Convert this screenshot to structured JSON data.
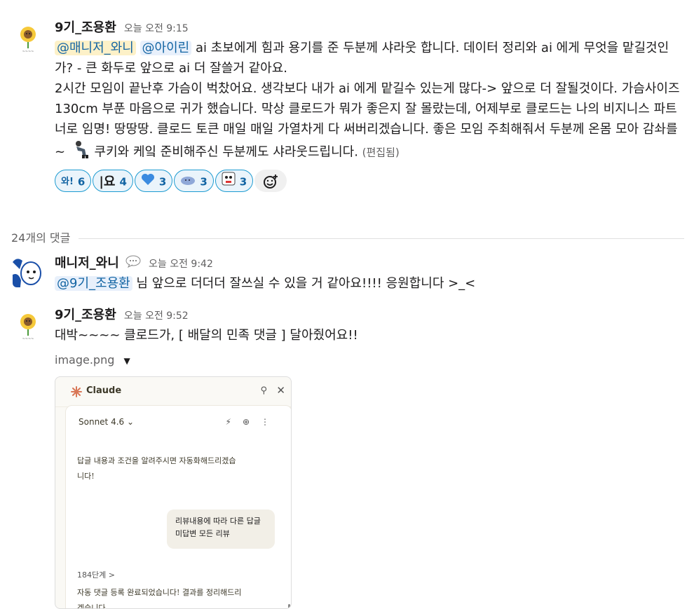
{
  "thread": {
    "main_message": {
      "author": "9기_조용환",
      "time": "오늘 오전 9:15",
      "mention1": "@매니저_와니",
      "mention2": "@아이린",
      "text_seg1": " ai 초보에게 힘과 용기를 준 두분께 샤라웃 합니다.  데이터 정리와  ai 에게 무엇을 맡길것인가? - 큰 화두로 앞으로 ai 더 잘쓸거 같아요.",
      "text_seg2": "2시간 모임이 끝난후 가슴이 벅찼어요.  생각보다 내가 ai 에게 맡길수 있는게 많다-> 앞으로 더 잘될것이다. 가슴사이즈 130cm 부푼 마음으로 귀가 했습니다.  막상 클로드가 뭐가 좋은지 잘 몰랐는데, 어제부로 클로드는 나의 비지니스 파트너로 임명! 땅땅땅.  클로드 토큰 매일 매일 가열차게 다 써버리겠습니다.  좋은 모임 주최해줘서 두분께 온몸 모아 감솨를~",
      "text_seg3": "       쿠키와 케잌 준비해주신 두분께도 샤라웃드립니다.",
      "edited": "(편집됨)",
      "reactions": [
        {
          "icon": "wow-badge-icon",
          "label": "와!",
          "count": "6"
        },
        {
          "icon": "yo-badge-icon",
          "label": "|요",
          "count": "4"
        },
        {
          "icon": "blue-heart-icon",
          "label": "",
          "count": "3"
        },
        {
          "icon": "blob-emoji-icon",
          "label": "",
          "count": "3"
        },
        {
          "icon": "face-emoji-icon",
          "label": "",
          "count": "3"
        }
      ]
    },
    "reply_count_label": "24개의 댓글",
    "reply1": {
      "author": "매니저_와니",
      "time": "오늘 오전 9:42",
      "mention": "@9기_조용환",
      "text": " 님 앞으로 더더더 잘쓰실 수 있을 거 같아요!!!! 응원합니다 >_<"
    },
    "reply2": {
      "author": "9기_조용환",
      "time": "오늘 오전 9:52",
      "text": "대박~~~~  클로드가, [ 배달의 민족 댓글 ] 달아줬어요!!",
      "file_name": "image.png"
    }
  },
  "attachment": {
    "app_title": "Claude",
    "model": "Sonnet 4.6 ⌄",
    "bot_msg1_line1": "답글 내용과 조건을 알려주시면 자동화해드리겠습",
    "bot_msg1_line2": "니다!",
    "user_line1": "리뷰내용에 따라 다른 답글",
    "user_line2": "미답변 모든 리뷰",
    "steps": "184단계 >",
    "bot_msg2_line1": "자동 댓글 등록 완료되었습니다! 결과를 정리해드리",
    "bot_msg2_line2": "겠습니다."
  },
  "colors": {
    "mention_bg": "#e8f0fb",
    "mention_text": "#1264a3",
    "reaction_border": "#1d9bd1",
    "reaction_bg": "#eaf4fb",
    "claude_accent": "#d97757"
  }
}
